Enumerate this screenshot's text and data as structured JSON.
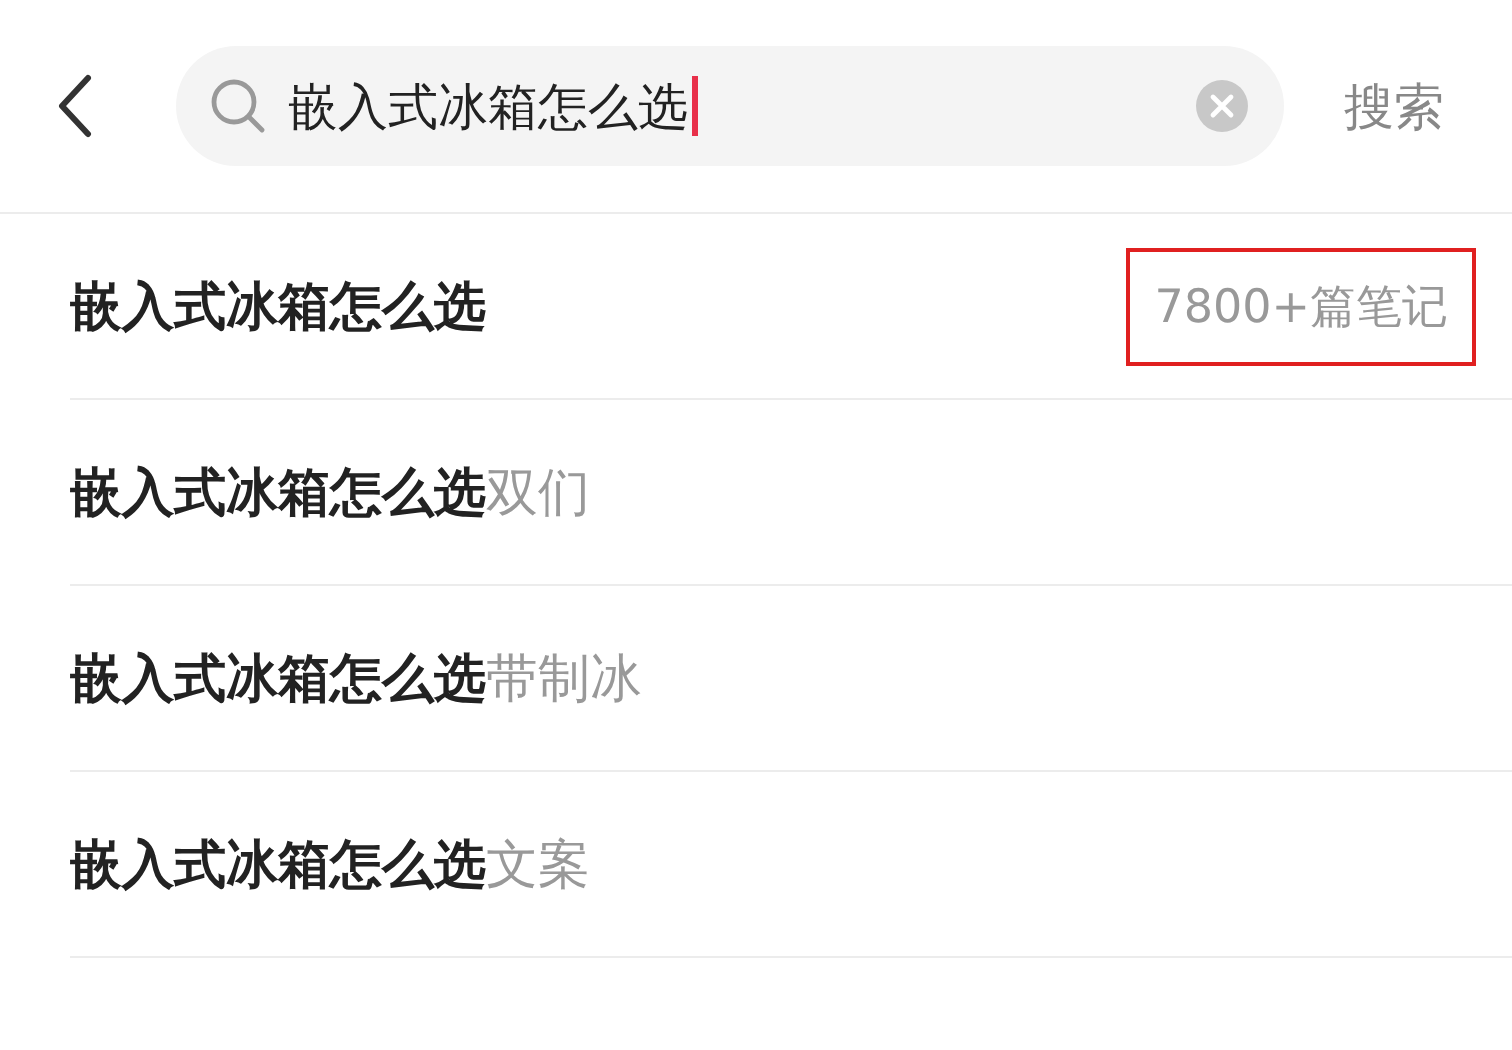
{
  "search": {
    "value": "嵌入式冰箱怎么选",
    "button": "搜索"
  },
  "suggestions": [
    {
      "query": "嵌入式冰箱怎么选",
      "count": "7800+篇笔记"
    },
    {
      "query": "嵌入式冰箱怎么选",
      "suffix": "双们"
    },
    {
      "query": "嵌入式冰箱怎么选",
      "suffix": "带制冰"
    },
    {
      "query": "嵌入式冰箱怎么选",
      "suffix": "文案"
    }
  ]
}
